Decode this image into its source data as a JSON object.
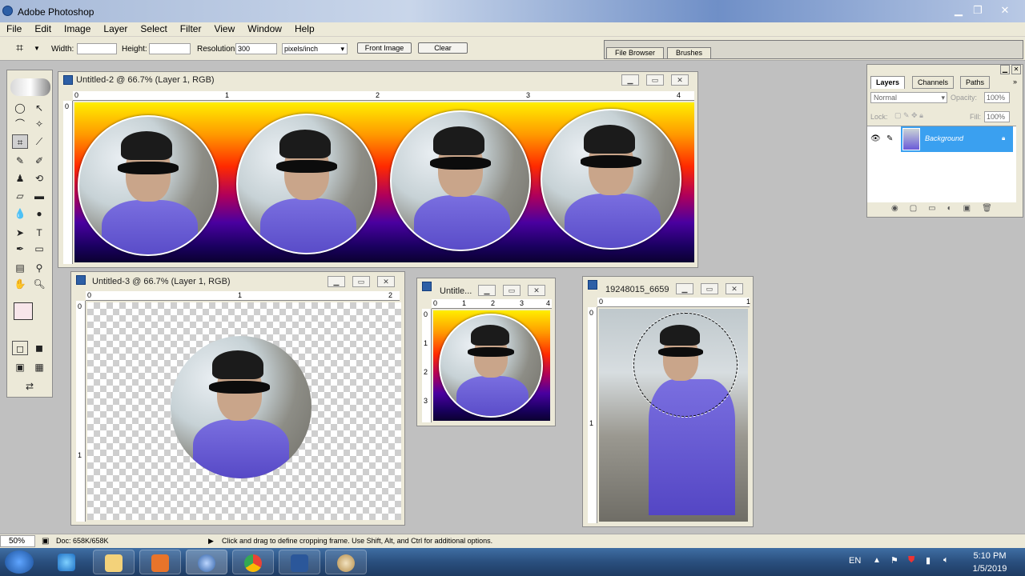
{
  "app": {
    "title": "Adobe Photoshop"
  },
  "menu": {
    "items": [
      "File",
      "Edit",
      "Image",
      "Layer",
      "Select",
      "Filter",
      "View",
      "Window",
      "Help"
    ]
  },
  "options": {
    "width_label": "Width:",
    "height_label": "Height:",
    "resolution_label": "Resolution:",
    "resolution_value": "300",
    "units_value": "pixels/inch",
    "front_image": "Front Image",
    "clear": "Clear"
  },
  "palette_well": {
    "tabs": [
      "File Browser",
      "Brushes"
    ]
  },
  "documents": [
    {
      "title": "Untitled-2 @ 66.7% (Layer 1, RGB)",
      "ruler": [
        "0",
        "1",
        "2",
        "3",
        "4"
      ]
    },
    {
      "title": "Untitled-3 @ 66.7% (Layer 1, RGB)",
      "ruler": [
        "0",
        "1",
        "2"
      ],
      "vruler": [
        "0",
        "1"
      ]
    },
    {
      "title": "Untitle...",
      "ruler": [
        "0",
        "1",
        "2",
        "3",
        "4"
      ],
      "vruler": [
        "0",
        "1",
        "2",
        "3"
      ]
    },
    {
      "title": "19248015_6659...",
      "ruler": [
        "0",
        "1"
      ],
      "vruler": [
        "0",
        "1"
      ]
    }
  ],
  "layers_panel": {
    "tabs": [
      "Layers",
      "Channels",
      "Paths"
    ],
    "blend_mode": "Normal",
    "opacity_label": "Opacity:",
    "opacity_value": "100%",
    "lock_label": "Lock:",
    "fill_label": "Fill:",
    "fill_value": "100%",
    "layer_name": "Background"
  },
  "status": {
    "zoom": "50%",
    "doc": "Doc: 658K/658K",
    "hint": "Click and drag to define cropping frame. Use Shift, Alt, and Ctrl for additional options."
  },
  "taskbar": {
    "lang": "EN",
    "time": "5:10 PM",
    "date": "1/5/2019"
  },
  "colors": {
    "accent": "#3aa0f0",
    "shirt": "#6a5ad8"
  }
}
